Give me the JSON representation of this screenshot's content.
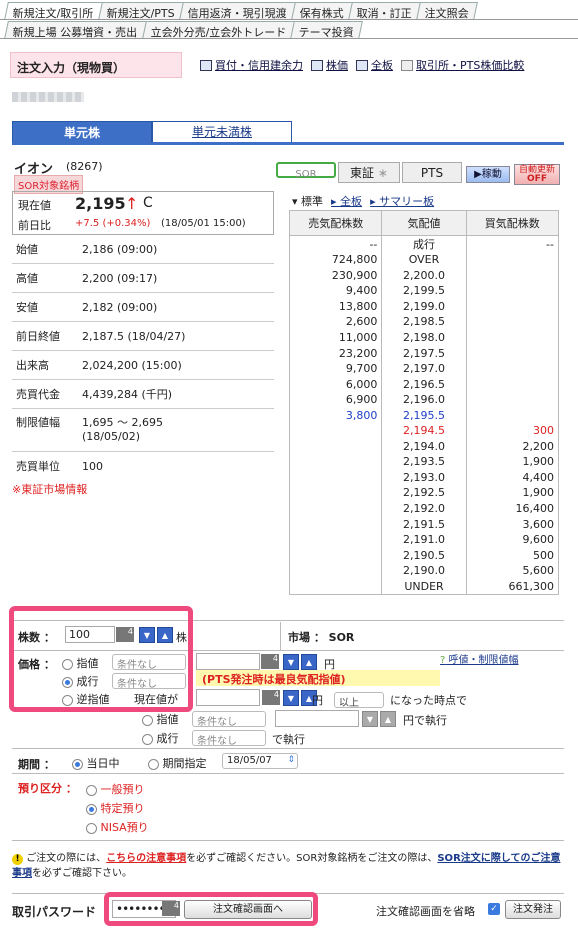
{
  "tabs_row1": [
    "新規注文/取引所",
    "新規注文/PTS",
    "信用返済・現引現渡",
    "保有株式",
    "取消・訂正",
    "注文照会"
  ],
  "tabs_row2": [
    "新規上場 公募増資・売出",
    "立会外分売/立会外トレード",
    "テーマ投資"
  ],
  "header": {
    "title": "注文入力（現物買）",
    "links": [
      "買付・信用建余力",
      "株価",
      "全板",
      "取引所・PTS株価比較"
    ]
  },
  "unit_tabs": [
    "単元株",
    "単元未満株"
  ],
  "stock": {
    "name": "イオン",
    "code": "(8267)",
    "badge": "SOR対象銘柄",
    "current_label": "現在値",
    "current_price": "2,195",
    "arrow": "↑",
    "price_flag": "C",
    "change_label": "前日比",
    "change": "+7.5 (+0.34%)",
    "change_time": "(18/05/01 15:00)"
  },
  "info": [
    {
      "k": "始値",
      "v": "2,186 (09:00)"
    },
    {
      "k": "高値",
      "v": "2,200 (09:17)"
    },
    {
      "k": "安値",
      "v": "2,182 (09:00)"
    },
    {
      "k": "前日終値",
      "v": "2,187.5 (18/04/27)"
    },
    {
      "k": "出来高",
      "v": "2,024,200 (15:00)"
    },
    {
      "k": "売買代金",
      "v": "4,439,284 (千円)"
    },
    {
      "k": "制限値幅",
      "v": "1,695 ～ 2,695",
      "v2": "(18/05/02)"
    },
    {
      "k": "売買単位",
      "v": "100"
    }
  ],
  "tosho_link": "※東証市場情報",
  "markets": {
    "sor": "SOR",
    "tosho": "東証",
    "tosho_star": "∗",
    "pts": "PTS",
    "auto": "▶稼動",
    "auto_update": "自動更新",
    "off": "OFF"
  },
  "board_links": {
    "std": "▾ 標準",
    "full": "▸ 全板",
    "summary": "▸ サマリー板"
  },
  "board": {
    "headers": [
      "売気配株数",
      "気配値",
      "買気配株数"
    ],
    "rows": [
      {
        "a": "--",
        "p": "成行",
        "b": "--"
      },
      {
        "a": "724,800",
        "p": "OVER",
        "b": ""
      },
      {
        "a": "230,900",
        "p": "2,200.0",
        "b": ""
      },
      {
        "a": "9,400",
        "p": "2,199.5",
        "b": ""
      },
      {
        "a": "13,800",
        "p": "2,199.0",
        "b": ""
      },
      {
        "a": "2,600",
        "p": "2,198.5",
        "b": ""
      },
      {
        "a": "11,000",
        "p": "2,198.0",
        "b": ""
      },
      {
        "a": "23,200",
        "p": "2,197.5",
        "b": ""
      },
      {
        "a": "9,700",
        "p": "2,197.0",
        "b": ""
      },
      {
        "a": "6,000",
        "p": "2,196.5",
        "b": ""
      },
      {
        "a": "6,900",
        "p": "2,196.0",
        "b": ""
      },
      {
        "a": "3,800",
        "p": "2,195.5",
        "b": "",
        "c": "blue"
      },
      {
        "a": "",
        "p": "2,194.5",
        "b": "300",
        "c": "red"
      },
      {
        "a": "",
        "p": "2,194.0",
        "b": "2,200"
      },
      {
        "a": "",
        "p": "2,193.5",
        "b": "1,900"
      },
      {
        "a": "",
        "p": "2,193.0",
        "b": "4,400"
      },
      {
        "a": "",
        "p": "2,192.5",
        "b": "1,900"
      },
      {
        "a": "",
        "p": "2,192.0",
        "b": "16,400"
      },
      {
        "a": "",
        "p": "2,191.5",
        "b": "3,600"
      },
      {
        "a": "",
        "p": "2,191.0",
        "b": "9,600"
      },
      {
        "a": "",
        "p": "2,190.5",
        "b": "500"
      },
      {
        "a": "",
        "p": "2,190.0",
        "b": "5,600"
      },
      {
        "a": "",
        "p": "UNDER",
        "b": "661,300"
      }
    ]
  },
  "order": {
    "qty_label": "株数 ：",
    "qty_value": "100",
    "qty_suffix": "株",
    "market_label": "市場 ： SOR",
    "price_label": "価格 ：",
    "limit": "指値",
    "market_order": "成行",
    "stop": "逆指値",
    "cond_none": "条件なし",
    "yen": "円",
    "price_note": "(PTS発注時は最良気配指値)",
    "tick_link": "呼値・制限値幅",
    "current_price_is": "現在値が",
    "above": "以上",
    "when_reached": "になった時点で",
    "limit_exec": "で執行",
    "market_exec": "で執行",
    "period_label": "期間 ：",
    "today": "当日中",
    "period_specify": "期間指定",
    "period_date": "18/05/07",
    "custody_label": "預り区分 ：",
    "custody": [
      "一般預り",
      "特定預り",
      "NISA預り"
    ]
  },
  "notice": {
    "pre": "ご注文の際には、",
    "link1": "こちらの注意事項",
    "mid": "を必ずご確認ください。SOR対象銘柄をご注文の際は、",
    "link2": "SOR注文に際してのご注意事項",
    "post": "を必ずご確認下さい。"
  },
  "password": {
    "label": "取引パスワード",
    "value": "••••••••••"
  },
  "buttons": {
    "confirm": "注文確認画面へ",
    "skip_label": "注文確認画面を省略",
    "place": "注文発注"
  },
  "colors": {
    "accent": "#3d6fc6",
    "highlight": "#ee4a7e",
    "sell": "#1e40c8",
    "buy": "#d22222"
  }
}
